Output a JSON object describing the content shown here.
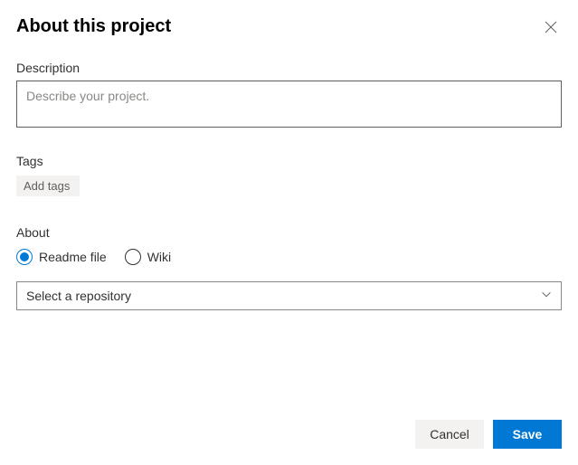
{
  "header": {
    "title": "About this project"
  },
  "description": {
    "label": "Description",
    "placeholder": "Describe your project.",
    "value": ""
  },
  "tags": {
    "label": "Tags",
    "placeholder": "Add tags",
    "value": ""
  },
  "about": {
    "label": "About",
    "options": [
      {
        "label": "Readme file",
        "selected": true
      },
      {
        "label": "Wiki",
        "selected": false
      }
    ],
    "repo_select": {
      "placeholder": "Select a repository",
      "value": ""
    }
  },
  "footer": {
    "cancel_label": "Cancel",
    "save_label": "Save"
  }
}
